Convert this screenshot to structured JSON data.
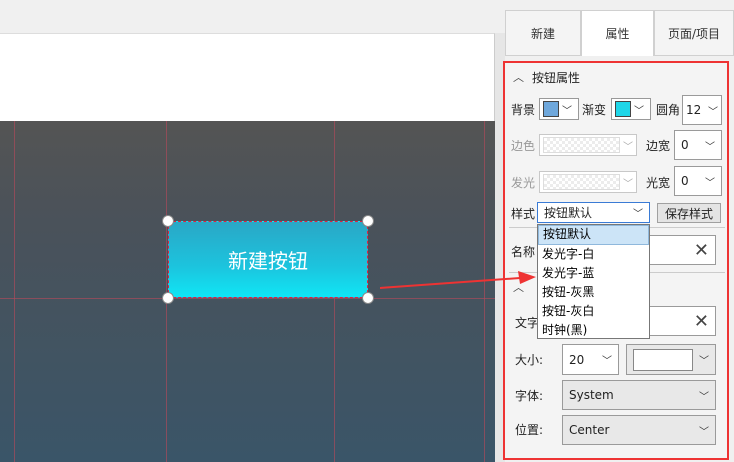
{
  "tabs": [
    {
      "label": "新建"
    },
    {
      "label": "属性"
    },
    {
      "label": "页面/项目"
    }
  ],
  "canvas": {
    "button_text": "新建按钮"
  },
  "button_props": {
    "section_title": "按钮属性",
    "bg_label": "背景",
    "gradient_label": "渐变",
    "radius_label": "圆角",
    "radius_value": "12",
    "border_color_label": "边色",
    "border_width_label": "边宽",
    "border_width_value": "0",
    "glow_label": "发光",
    "glow_width_label": "光宽",
    "glow_width_value": "0",
    "style_label": "样式",
    "style_value": "按钮默认",
    "save_style_label": "保存样式",
    "name_label": "名称",
    "bg_color": "#6fa8dc",
    "gradient_color": "#1fd6e8"
  },
  "style_options": [
    "按钮默认",
    "发光字-白",
    "发光字-蓝",
    "按钮-灰黑",
    "按钮-灰白",
    "时钟(黑)"
  ],
  "text_props": {
    "text_label": "文字",
    "size_label": "大小:",
    "size_value": "20",
    "font_label": "字体:",
    "font_value": "System",
    "position_label": "位置:",
    "position_value": "Center"
  },
  "colors": {
    "highlight_border": "#e33333",
    "button_gradient_top": "#2aa7c6",
    "button_gradient_bottom": "#10e6f5"
  }
}
